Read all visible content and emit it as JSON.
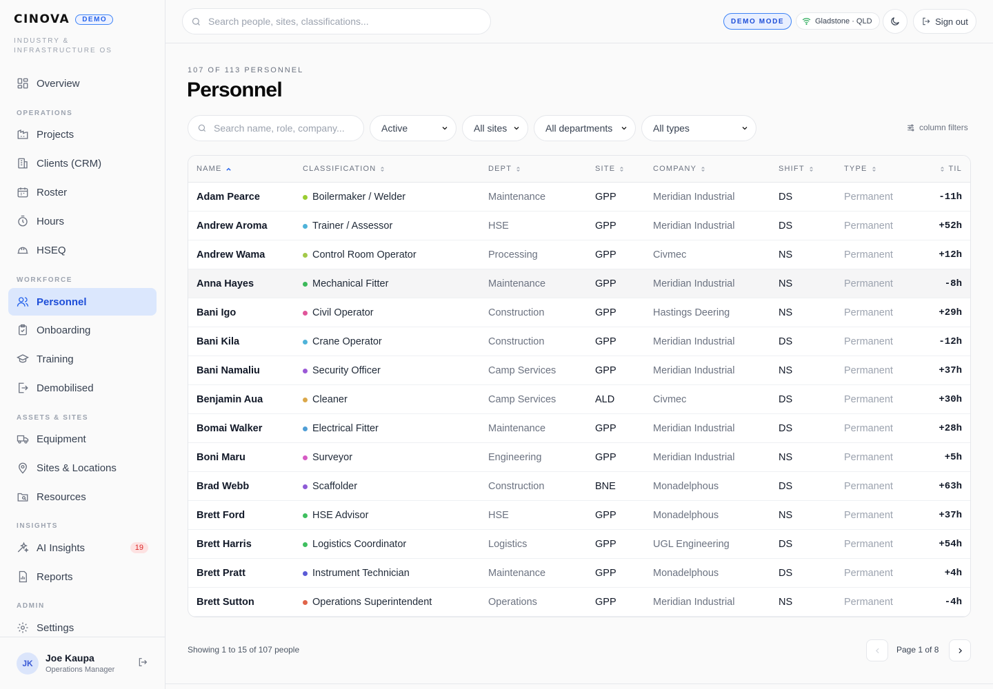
{
  "brand": {
    "logo": "CINOVA",
    "tag": "DEMO",
    "subtitle": "INDUSTRY & INFRASTRUCTURE OS"
  },
  "nav": {
    "overview": "Overview",
    "sections": {
      "operations": "OPERATIONS",
      "workforce": "WORKFORCE",
      "assets": "ASSETS & SITES",
      "insights": "INSIGHTS",
      "admin": "ADMIN"
    },
    "projects": "Projects",
    "clients": "Clients (CRM)",
    "roster": "Roster",
    "hours": "Hours",
    "hseq": "HSEQ",
    "personnel": "Personnel",
    "onboarding": "Onboarding",
    "training": "Training",
    "demobilised": "Demobilised",
    "equipment": "Equipment",
    "sites": "Sites & Locations",
    "resources": "Resources",
    "ai_insights": "AI Insights",
    "ai_insights_badge": "19",
    "reports": "Reports",
    "settings": "Settings"
  },
  "user": {
    "initials": "JK",
    "name": "Joe Kaupa",
    "role": "Operations Manager"
  },
  "topbar": {
    "search_placeholder": "Search people, sites, classifications...",
    "demo_mode": "DEMO MODE",
    "location": "Gladstone · QLD",
    "sign_out": "Sign out"
  },
  "page": {
    "counter": "107 OF 113 PERSONNEL",
    "title": "Personnel",
    "search_placeholder": "Search name, role, company...",
    "filters": {
      "status": "Active",
      "site": "All sites",
      "department": "All departments",
      "type": "All types"
    },
    "column_filters": "column filters"
  },
  "table": {
    "headers": {
      "name": "NAME",
      "classification": "CLASSIFICATION",
      "dept": "DEPT",
      "site": "SITE",
      "company": "COMPANY",
      "shift": "SHIFT",
      "type": "TYPE",
      "til": "TIL"
    },
    "rows": [
      {
        "name": "Adam Pearce",
        "classification": "Boilermaker / Welder",
        "dot": "#9acd32",
        "dept": "Maintenance",
        "site": "GPP",
        "company": "Meridian Industrial",
        "shift": "DS",
        "type": "Permanent",
        "til": "-11h"
      },
      {
        "name": "Andrew Aroma",
        "classification": "Trainer / Assessor",
        "dot": "#4fb3d9",
        "dept": "HSE",
        "site": "GPP",
        "company": "Meridian Industrial",
        "shift": "DS",
        "type": "Permanent",
        "til": "+52h"
      },
      {
        "name": "Andrew Wama",
        "classification": "Control Room Operator",
        "dot": "#a3c94a",
        "dept": "Processing",
        "site": "GPP",
        "company": "Civmec",
        "shift": "NS",
        "type": "Permanent",
        "til": "+12h"
      },
      {
        "name": "Anna Hayes",
        "classification": "Mechanical Fitter",
        "dot": "#3cb95a",
        "dept": "Maintenance",
        "site": "GPP",
        "company": "Meridian Industrial",
        "shift": "NS",
        "type": "Permanent",
        "til": "-8h"
      },
      {
        "name": "Bani Igo",
        "classification": "Civil Operator",
        "dot": "#e0559a",
        "dept": "Construction",
        "site": "GPP",
        "company": "Hastings Deering",
        "shift": "NS",
        "type": "Permanent",
        "til": "+29h"
      },
      {
        "name": "Bani Kila",
        "classification": "Crane Operator",
        "dot": "#4fb3d9",
        "dept": "Construction",
        "site": "GPP",
        "company": "Meridian Industrial",
        "shift": "DS",
        "type": "Permanent",
        "til": "-12h"
      },
      {
        "name": "Bani Namaliu",
        "classification": "Security Officer",
        "dot": "#9b59d6",
        "dept": "Camp Services",
        "site": "GPP",
        "company": "Meridian Industrial",
        "shift": "NS",
        "type": "Permanent",
        "til": "+37h"
      },
      {
        "name": "Benjamin Aua",
        "classification": "Cleaner",
        "dot": "#dba84a",
        "dept": "Camp Services",
        "site": "ALD",
        "company": "Civmec",
        "shift": "DS",
        "type": "Permanent",
        "til": "+30h"
      },
      {
        "name": "Bomai Walker",
        "classification": "Electrical Fitter",
        "dot": "#4f9ed6",
        "dept": "Maintenance",
        "site": "GPP",
        "company": "Meridian Industrial",
        "shift": "DS",
        "type": "Permanent",
        "til": "+28h"
      },
      {
        "name": "Boni Maru",
        "classification": "Surveyor",
        "dot": "#d65bc4",
        "dept": "Engineering",
        "site": "GPP",
        "company": "Meridian Industrial",
        "shift": "NS",
        "type": "Permanent",
        "til": "+5h"
      },
      {
        "name": "Brad Webb",
        "classification": "Scaffolder",
        "dot": "#8e5bd6",
        "dept": "Construction",
        "site": "BNE",
        "company": "Monadelphous",
        "shift": "DS",
        "type": "Permanent",
        "til": "+63h"
      },
      {
        "name": "Brett Ford",
        "classification": "HSE Advisor",
        "dot": "#3fbf5f",
        "dept": "HSE",
        "site": "GPP",
        "company": "Monadelphous",
        "shift": "NS",
        "type": "Permanent",
        "til": "+37h"
      },
      {
        "name": "Brett Harris",
        "classification": "Logistics Coordinator",
        "dot": "#3fbf5f",
        "dept": "Logistics",
        "site": "GPP",
        "company": "UGL Engineering",
        "shift": "DS",
        "type": "Permanent",
        "til": "+54h"
      },
      {
        "name": "Brett Pratt",
        "classification": "Instrument Technician",
        "dot": "#5b5bd6",
        "dept": "Maintenance",
        "site": "GPP",
        "company": "Monadelphous",
        "shift": "DS",
        "type": "Permanent",
        "til": "+4h"
      },
      {
        "name": "Brett Sutton",
        "classification": "Operations Superintendent",
        "dot": "#e0644a",
        "dept": "Operations",
        "site": "GPP",
        "company": "Meridian Industrial",
        "shift": "NS",
        "type": "Permanent",
        "til": "-4h"
      }
    ]
  },
  "pagination": {
    "showing": "Showing 1 to 15 of 107 people",
    "page": "Page 1 of 8"
  }
}
